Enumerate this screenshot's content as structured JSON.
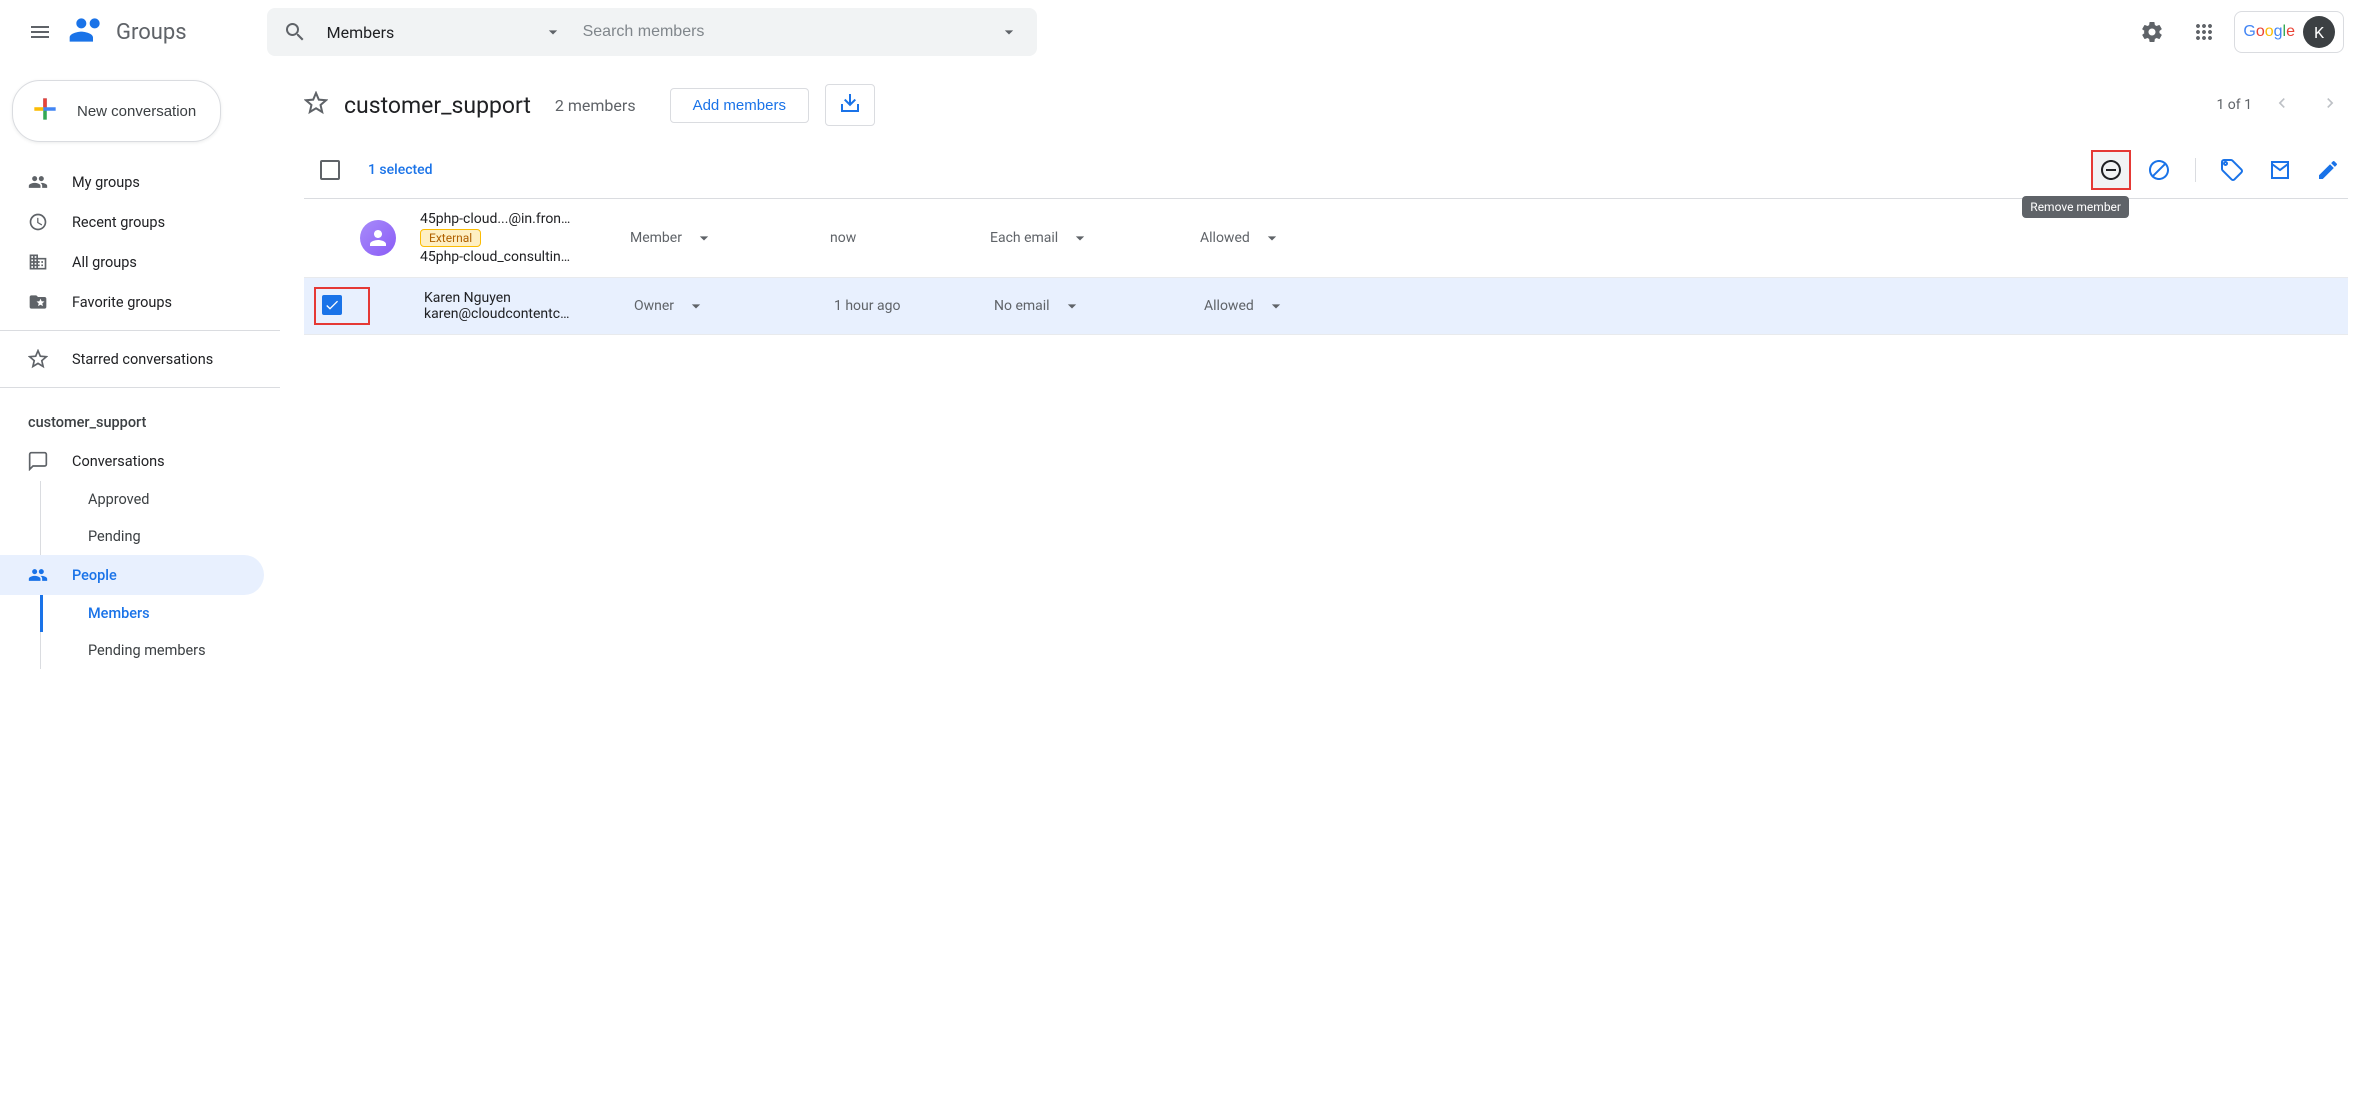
{
  "header": {
    "logo_text": "Groups",
    "search_scope": "Members",
    "search_placeholder": "Search members",
    "account_initial": "K"
  },
  "sidebar": {
    "new_conversation": "New conversation",
    "nav": {
      "my_groups": "My groups",
      "recent_groups": "Recent groups",
      "all_groups": "All groups",
      "favorite_groups": "Favorite groups",
      "starred": "Starred conversations"
    },
    "group_name": "customer_support",
    "group_nav": {
      "conversations": "Conversations",
      "approved": "Approved",
      "pending": "Pending",
      "people": "People",
      "members": "Members",
      "pending_members": "Pending members"
    }
  },
  "page": {
    "title": "customer_support",
    "member_count": "2 members",
    "add_members": "Add members",
    "pagination": "1 of 1"
  },
  "toolbar": {
    "selected_text": "1 selected",
    "tooltip_remove": "Remove member"
  },
  "members": [
    {
      "name": "45php-cloud...@in.fron…",
      "external": "External",
      "email": "45php-cloud_consultin…",
      "role": "Member",
      "joined": "now",
      "subscription": "Each email",
      "posting": "Allowed",
      "selected": false
    },
    {
      "name": "Karen Nguyen",
      "email": "karen@cloudcontentc…",
      "role": "Owner",
      "joined": "1 hour ago",
      "subscription": "No email",
      "posting": "Allowed",
      "selected": true
    }
  ]
}
